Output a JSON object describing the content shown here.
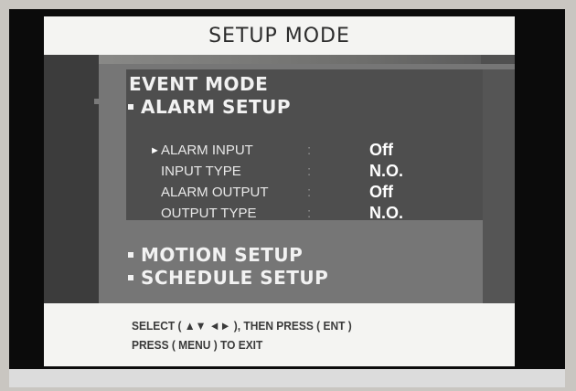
{
  "title": "SETUP MODE",
  "section": "EVENT MODE",
  "submenu": {
    "label": "ALARM SETUP",
    "rows": [
      {
        "label": "ALARM INPUT",
        "value": "Off",
        "selected": true
      },
      {
        "label": "INPUT TYPE",
        "value": "N.O.",
        "selected": false
      },
      {
        "label": "ALARM OUTPUT",
        "value": "Off",
        "selected": false
      },
      {
        "label": "OUTPUT TYPE",
        "value": "N.O.",
        "selected": false
      }
    ],
    "separator": ":"
  },
  "other_items": [
    {
      "label": "MOTION SETUP"
    },
    {
      "label": "SCHEDULE SETUP"
    }
  ],
  "footer": {
    "line1": "SELECT ( ▲▼ ◄► ), THEN PRESS ( ENT )",
    "line2": "PRESS ( MENU ) TO EXIT"
  },
  "colors": {
    "title_bg": "#f4f4f2",
    "panel_dark": "#4e4e4e",
    "panel_light": "#767676",
    "text": "#f2f2f2"
  },
  "icons": {
    "selection_marker": "triangle-right-icon",
    "bullet": "square-bullet-icon"
  }
}
